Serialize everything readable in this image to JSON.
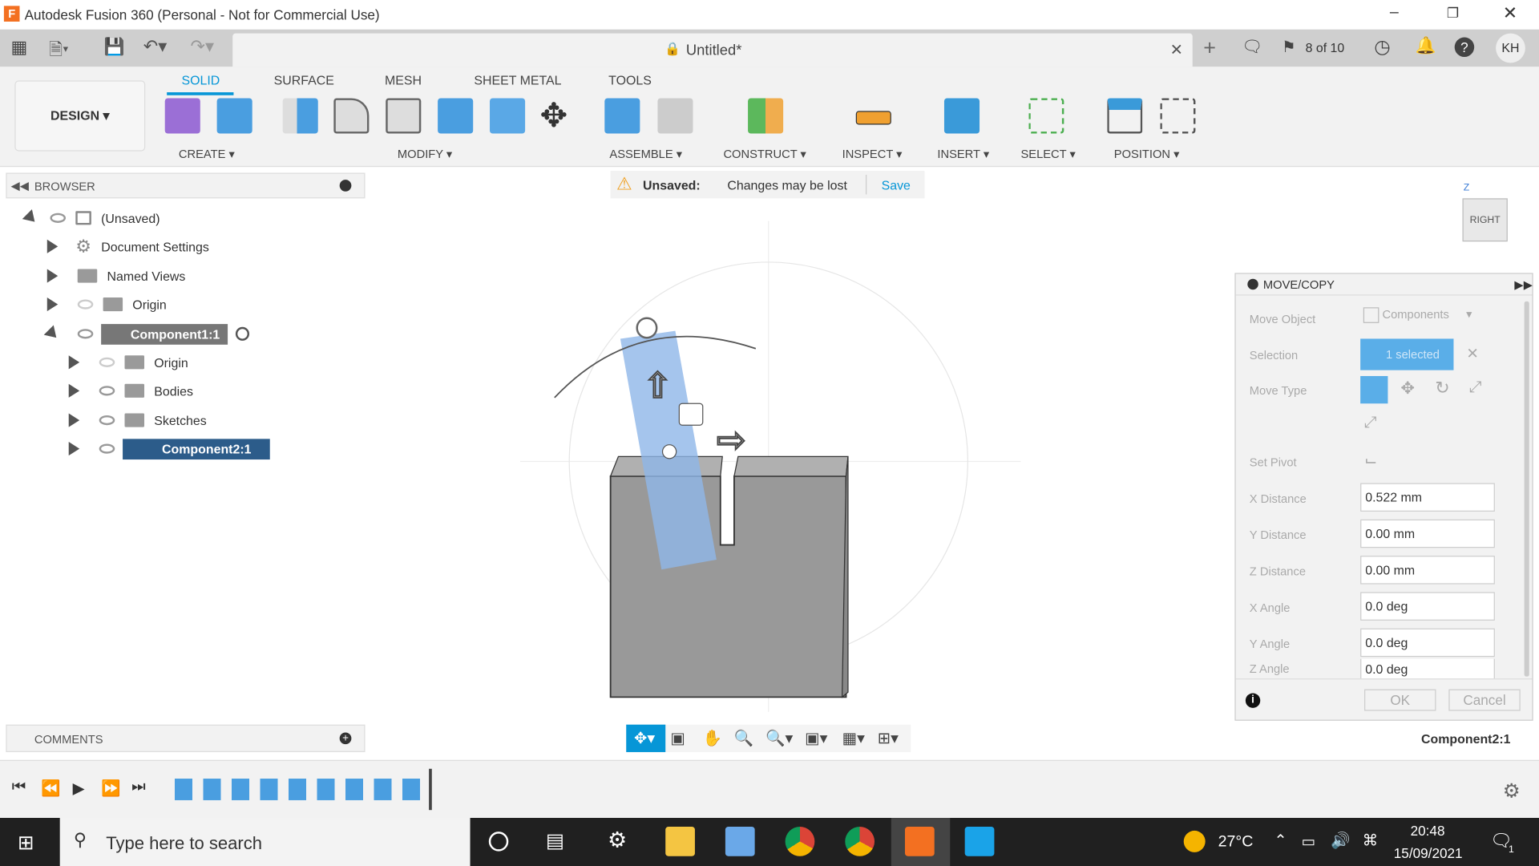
{
  "window": {
    "title": "Autodesk Fusion 360 (Personal - Not for Commercial Use)"
  },
  "doc": {
    "title": "Untitled*",
    "jobs": "8 of 10",
    "user": "KH"
  },
  "ribbon": {
    "workspace": "DESIGN",
    "tabs": [
      "SOLID",
      "SURFACE",
      "MESH",
      "SHEET METAL",
      "TOOLS"
    ],
    "active_tab": "SOLID",
    "groups": [
      "CREATE",
      "MODIFY",
      "ASSEMBLE",
      "CONSTRUCT",
      "INSPECT",
      "INSERT",
      "SELECT",
      "POSITION"
    ]
  },
  "accent": "#0696d7",
  "browser": {
    "title": "BROWSER",
    "items": [
      {
        "label": "(Unsaved)"
      },
      {
        "label": "Document Settings"
      },
      {
        "label": "Named Views"
      },
      {
        "label": "Origin"
      },
      {
        "label": "Component1:1"
      },
      {
        "label": "Origin"
      },
      {
        "label": "Bodies"
      },
      {
        "label": "Sketches"
      },
      {
        "label": "Component2:1"
      }
    ]
  },
  "banner": {
    "title": "Unsaved:",
    "message": "Changes may be lost",
    "save": "Save"
  },
  "viewcube": {
    "face": "RIGHT",
    "axis_z": "Z"
  },
  "movecopy": {
    "title": "MOVE/COPY",
    "move_object_label": "Move Object",
    "move_object_value": "Components",
    "selection_label": "Selection",
    "selection_value": "1 selected",
    "move_type_label": "Move Type",
    "set_pivot_label": "Set Pivot",
    "fields": [
      {
        "label": "X Distance",
        "value": "0.522 mm"
      },
      {
        "label": "Y Distance",
        "value": "0.00 mm"
      },
      {
        "label": "Z Distance",
        "value": "0.00 mm"
      },
      {
        "label": "X Angle",
        "value": "0.0 deg"
      },
      {
        "label": "Y Angle",
        "value": "0.0 deg"
      },
      {
        "label": "Z Angle",
        "value": "0.0 deg"
      }
    ],
    "ok": "OK",
    "cancel": "Cancel"
  },
  "status": {
    "selection": "Component2:1"
  },
  "comments": {
    "title": "COMMENTS"
  },
  "taskbar": {
    "search_placeholder": "Type here to search",
    "weather": "27°C",
    "time": "20:48",
    "date": "15/09/2021",
    "notifications": "1"
  }
}
